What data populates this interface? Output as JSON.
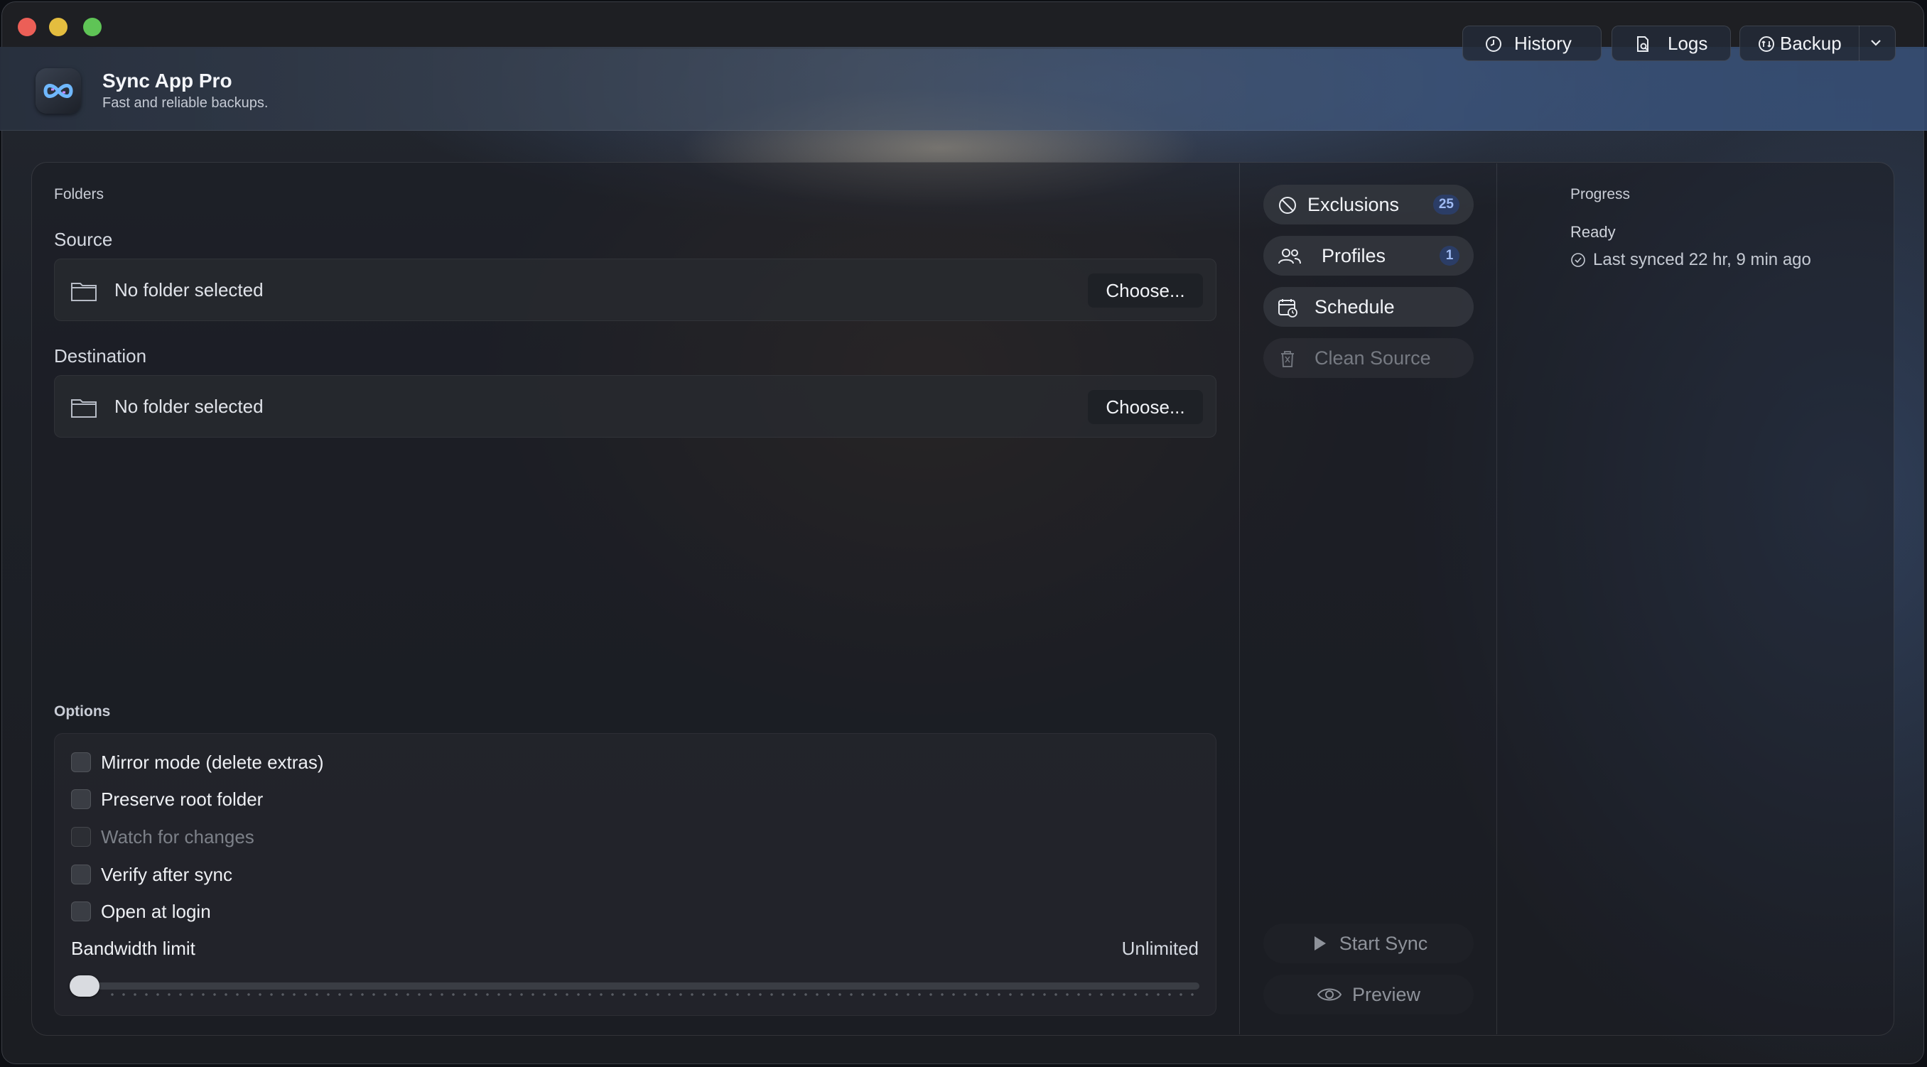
{
  "app": {
    "title": "Sync App Pro",
    "subtitle": "Fast and reliable backups."
  },
  "toolbar": {
    "history_label": "History",
    "logs_label": "Logs",
    "backup_label": "Backup"
  },
  "folders": {
    "section_label": "Folders",
    "source": {
      "label": "Source",
      "value": "No folder selected",
      "choose_label": "Choose..."
    },
    "destination": {
      "label": "Destination",
      "value": "No folder selected",
      "choose_label": "Choose..."
    }
  },
  "options": {
    "section_label": "Options",
    "items": [
      {
        "label": "Mirror mode (delete extras)",
        "checked": false,
        "enabled": true
      },
      {
        "label": "Preserve root folder",
        "checked": false,
        "enabled": true
      },
      {
        "label": "Watch for changes",
        "checked": false,
        "enabled": false
      },
      {
        "label": "Verify after sync",
        "checked": false,
        "enabled": true
      },
      {
        "label": "Open at login",
        "checked": false,
        "enabled": true
      }
    ],
    "bandwidth": {
      "label": "Bandwidth limit",
      "value": "Unlimited",
      "level": 0
    }
  },
  "side": {
    "exclusions": {
      "label": "Exclusions",
      "count": "25"
    },
    "profiles": {
      "label": "Profiles",
      "count": "1"
    },
    "schedule": {
      "label": "Schedule"
    },
    "clean_source": {
      "label": "Clean Source"
    },
    "start_sync": {
      "label": "Start Sync"
    },
    "preview": {
      "label": "Preview"
    }
  },
  "progress": {
    "section_label": "Progress",
    "status": "Ready",
    "last_synced": "Last synced 22 hr, 9 min ago"
  },
  "colors": {
    "accent_badge": "#2b3d66",
    "badge_text": "#9fbaf3",
    "close": "#ec5f57",
    "minimize": "#e4bd3f",
    "maximize": "#5fc456"
  }
}
